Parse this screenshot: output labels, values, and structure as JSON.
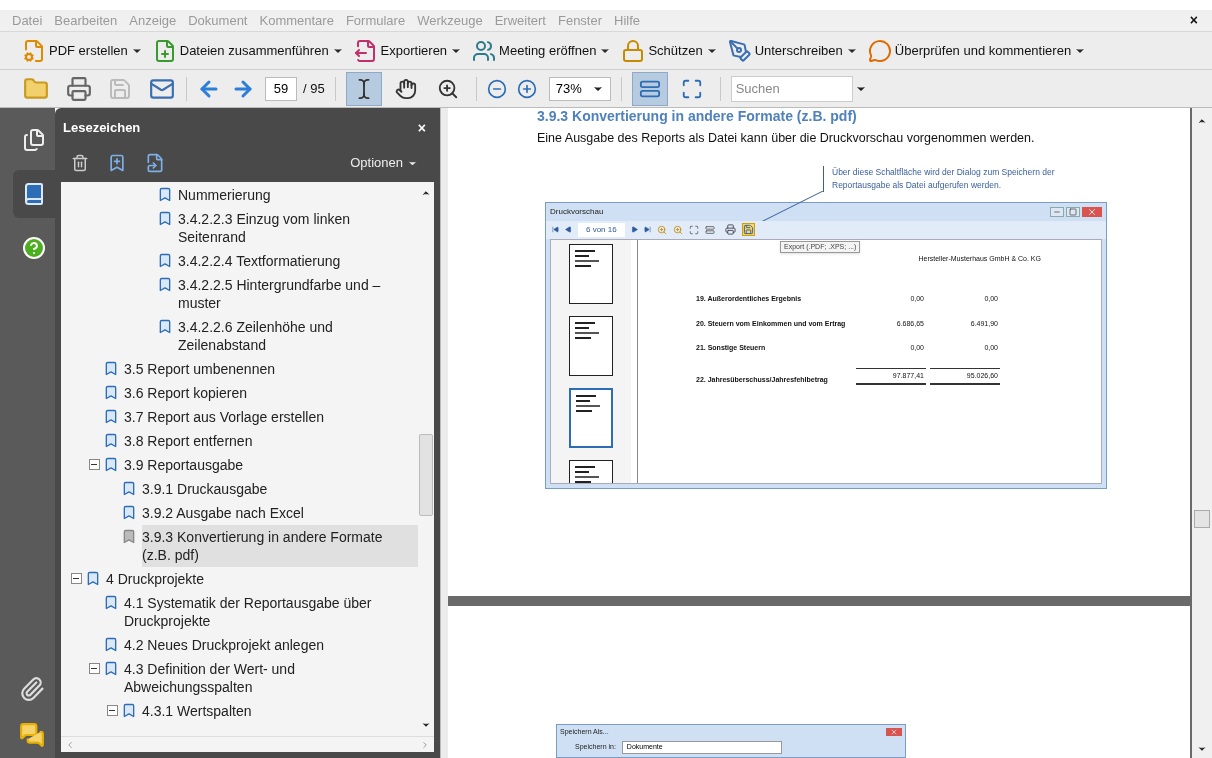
{
  "menu_bar": {
    "items": [
      "Datei",
      "Bearbeiten",
      "Anzeige",
      "Dokument",
      "Kommentare",
      "Formulare",
      "Werkzeuge",
      "Erweitert",
      "Fenster",
      "Hilfe"
    ],
    "close": "×"
  },
  "task_toolbar": [
    {
      "kind": "create-pdf",
      "label": "PDF erstellen"
    },
    {
      "kind": "combine",
      "label": "Dateien zusammenführen"
    },
    {
      "kind": "export",
      "label": "Exportieren"
    },
    {
      "kind": "meeting",
      "label": "Meeting eröffnen"
    },
    {
      "kind": "protect",
      "label": "Schützen"
    },
    {
      "kind": "sign",
      "label": "Unterschreiben"
    },
    {
      "kind": "review",
      "label": "Überprüfen und kommentieren"
    }
  ],
  "nav_toolbar": {
    "page": "59",
    "page_count": "/ 95",
    "zoom": "73%",
    "search": {
      "placeholder": "Suchen"
    },
    "tools": [
      {
        "kind": "select",
        "selected": true
      },
      {
        "kind": "hand",
        "selected": false
      },
      {
        "kind": "marquee-zoom",
        "selected": false
      }
    ],
    "view_modes": [
      {
        "kind": "fit-width",
        "selected": true
      },
      {
        "kind": "fit-page",
        "selected": false
      }
    ]
  },
  "side_tabs": [
    {
      "kind": "pages",
      "selected": false
    },
    {
      "kind": "bookmarks",
      "selected": true
    },
    {
      "kind": "help",
      "selected": false
    }
  ],
  "bookmarks_panel": {
    "title": "Lesezeichen",
    "close": "×",
    "options": "Optionen",
    "tree": [
      {
        "children": [
          {
            "children": [
              {
                "children": [
                  {
                    "children": [
                      {
                        "label": "Nummerierung",
                        "selected": false
                      },
                      {
                        "label": "3.4.2.2.3 Einzug vom linken Seitenrand",
                        "selected": false
                      },
                      {
                        "label": "3.4.2.2.4 Textformatierung",
                        "selected": false
                      },
                      {
                        "label": "3.4.2.2.5 Hintergrundfarbe und –muster",
                        "selected": false
                      },
                      {
                        "label": "3.4.2.2.6 Zeilenhöhe und Zeilenabstand",
                        "selected": false
                      }
                    ]
                  }
                ]
              }
            ]
          },
          {
            "label": "3.5 Report umbenennen",
            "selected": false
          },
          {
            "label": "3.6 Report kopieren",
            "selected": false
          },
          {
            "label": "3.7 Report aus Vorlage erstellen",
            "selected": false
          },
          {
            "label": "3.8 Report entfernen",
            "selected": false
          },
          {
            "label": "3.9 Reportausgabe",
            "selected": false,
            "expanded": true,
            "children": [
              {
                "label": "3.9.1 Druckausgabe",
                "selected": false
              },
              {
                "label": "3.9.2 Ausgabe nach Excel",
                "selected": false
              },
              {
                "label": "3.9.3 Konvertierung in andere Formate (z.B. pdf)",
                "selected": true
              }
            ]
          }
        ]
      },
      {
        "label": "4 Druckprojekte",
        "selected": false,
        "expanded": true,
        "children": [
          {
            "label": "4.1 Systematik der Reportausgabe über Druckprojekte",
            "selected": false
          },
          {
            "label": "4.2 Neues Druckprojekt anlegen",
            "selected": false
          },
          {
            "label": "4.3 Definition der Wert- und Abweichungsspalten",
            "selected": false,
            "expanded": true,
            "children": [
              {
                "label": "4.3.1 Wertspalten",
                "selected": false,
                "expanded": true
              }
            ]
          }
        ]
      }
    ]
  },
  "document": {
    "heading": "3.9.3  Konvertierung in andere Formate (z.B. pdf)",
    "paragraph": "Eine Ausgabe des Reports als Datei kann über die Druckvorschau vorgenommen werden.",
    "figure": {
      "callout": "Über diese Schaltfläche wird der Dialog zum Speichern der Reportausgabe als Datei aufgerufen werden.",
      "window": {
        "title": "Druckvorschau",
        "page_field": "6 von 16",
        "tooltip": "Export (.PDF; .XPS; ...)",
        "company": "Hersteller-Musterhaus GmbH & Co. KG",
        "rows": [
          {
            "kind": "line",
            "label": "19. Außerordentliches Ergebnis",
            "value_1": "0,00",
            "value_2": "0,00"
          },
          {
            "kind": "line",
            "label": "20. Steuern vom Einkommen und vom Ertrag",
            "value_1": "6.686,65",
            "value_2": "6.491,90"
          },
          {
            "kind": "line",
            "label": "21. Sonstige Steuern",
            "value_1": "0,00",
            "value_2": "0,00"
          },
          {
            "kind": "total",
            "label": "22. Jahresüberschuss/Jahresfehlbetrag",
            "value_1": "97.877,41",
            "value_2": "95.026,60"
          }
        ]
      }
    },
    "next_page": {
      "dialog_title": "Speichern Als...",
      "save_in_label": "Speichern in:",
      "folder": "Dokumente"
    }
  }
}
